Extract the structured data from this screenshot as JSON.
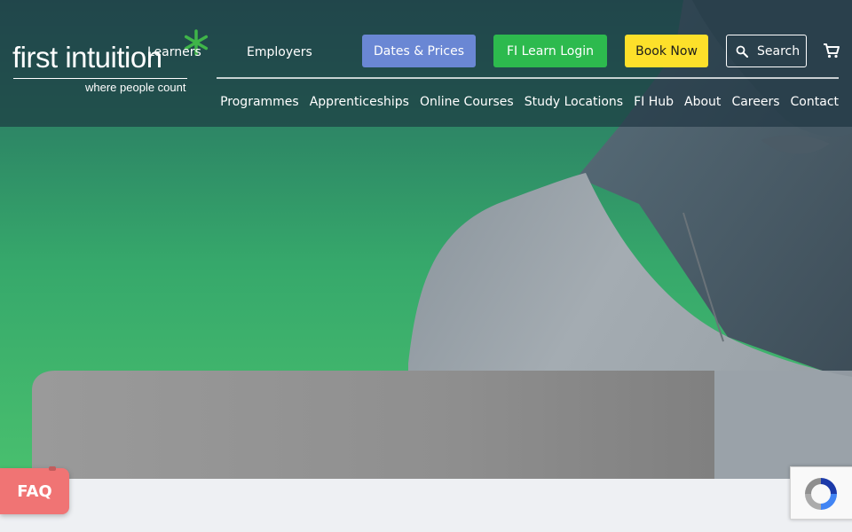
{
  "brand": {
    "name": "first intuition",
    "tagline": "where people count",
    "accent": "#3fb549"
  },
  "top_links": {
    "learners": "Learners",
    "employers": "Employers"
  },
  "actions": {
    "dates_prices": "Dates & Prices",
    "login": "FI Learn Login",
    "book_now": "Book Now",
    "search": "Search",
    "search_icon": "search-icon",
    "cart_icon": "shopping-cart-icon"
  },
  "colors": {
    "dates_prices": "#6a87d4",
    "login": "#2dba4e",
    "book_now": "#fde02a",
    "faq": "#f07474"
  },
  "nav": {
    "items": [
      "Programmes",
      "Apprenticeships",
      "Online Courses",
      "Study Locations",
      "FI Hub",
      "About",
      "Careers",
      "Contact"
    ]
  },
  "faq": {
    "label": "FAQ"
  },
  "recaptcha": {
    "icon": "recaptcha-icon"
  }
}
